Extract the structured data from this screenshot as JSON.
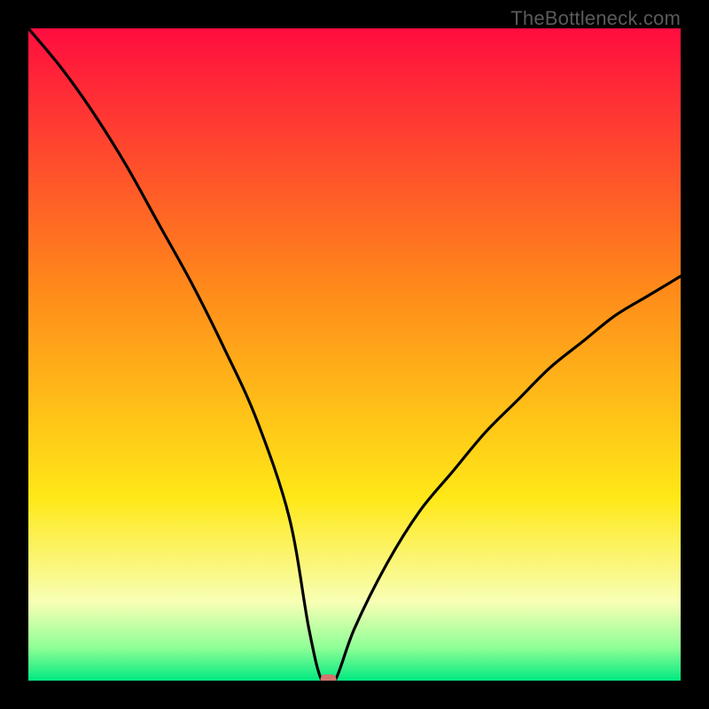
{
  "attribution": "TheBottleneck.com",
  "colors": {
    "red_top": "#ff0d3f",
    "orange_mid": "#ff8a1a",
    "yellow": "#ffe817",
    "pale": "#f8ffb5",
    "green_light": "#8eff96",
    "green": "#00e980",
    "black": "#000000",
    "curve": "#000000",
    "marker": "#d4756e"
  },
  "chart_data": {
    "type": "line",
    "title": "",
    "xlabel": "",
    "ylabel": "",
    "xlim": [
      0,
      100
    ],
    "ylim": [
      0,
      100
    ],
    "x": [
      0,
      5,
      10,
      15,
      20,
      25,
      30,
      35,
      40,
      43,
      45,
      47,
      50,
      55,
      60,
      65,
      70,
      75,
      80,
      85,
      90,
      95,
      100
    ],
    "values": [
      100,
      94,
      87,
      79,
      70,
      61,
      51,
      40,
      25,
      8,
      0,
      0,
      8,
      18,
      26,
      32,
      38,
      43,
      48,
      52,
      56,
      59,
      62
    ],
    "optimum_x": 46,
    "optimum_y": 0,
    "series": [
      {
        "name": "bottleneck_percent",
        "values": [
          100,
          94,
          87,
          79,
          70,
          61,
          51,
          40,
          25,
          8,
          0,
          0,
          8,
          18,
          26,
          32,
          38,
          43,
          48,
          52,
          56,
          59,
          62
        ]
      }
    ]
  }
}
